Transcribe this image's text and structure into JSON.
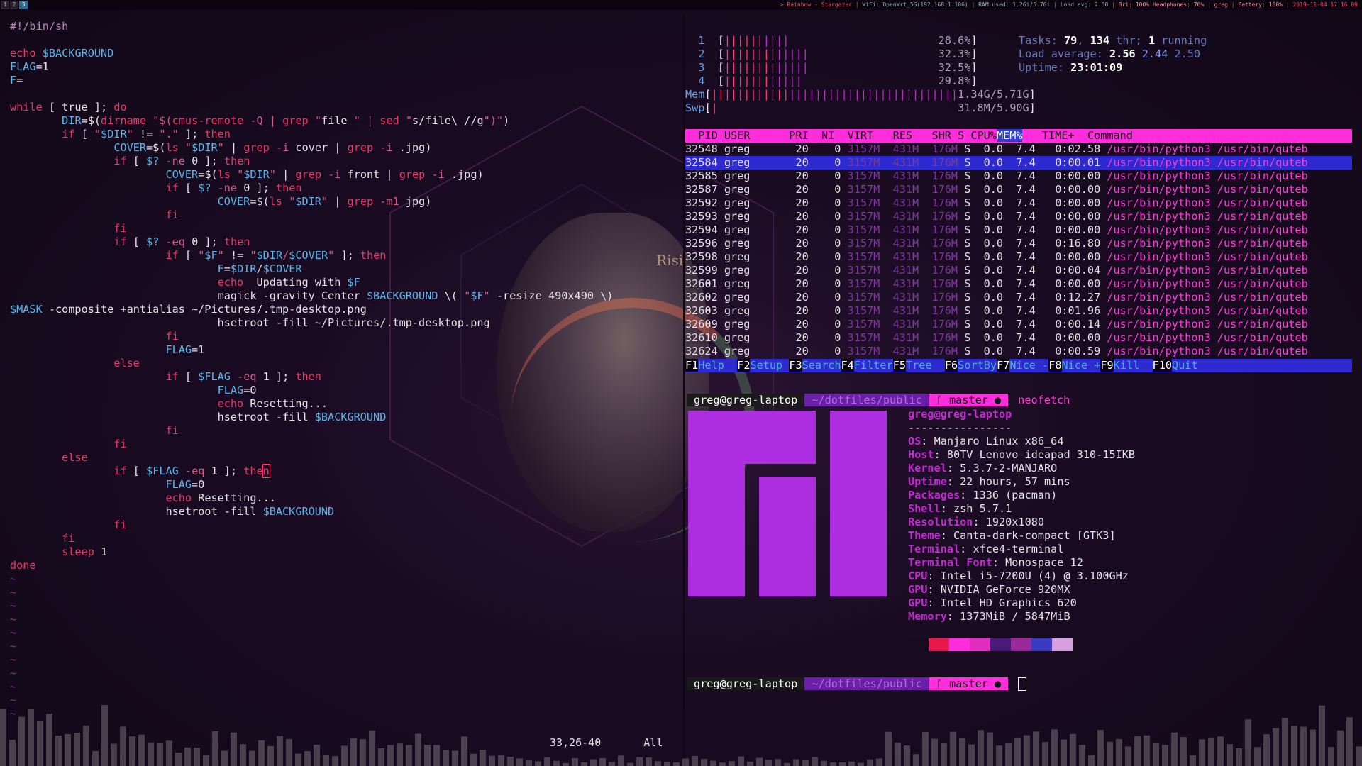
{
  "topbar": {
    "workspaces": [
      "1",
      "2",
      "3"
    ],
    "song": "> Rainbow - Stargazer",
    "wifi": "WiFi: OpenWrt_5G(192.168.1.106)",
    "ram": "RAM used: 1.2Gi/5.7Gi",
    "load": "Load avg: 2.50",
    "bri": "Bri: 100%",
    "headphones": "Headphones: 70%",
    "user": "greg",
    "battery": "Battery: 100%",
    "datetime": "2019-11-04 17:16:09"
  },
  "background": {
    "album_text": "Risi"
  },
  "vim": {
    "lines": [
      "#!/bin/sh",
      "",
      "echo $BACKGROUND",
      "FLAG=1",
      "F=",
      "",
      "while [ true ]; do",
      "        DIR=$(dirname \"$(cmus-remote -Q | grep \"file \" | sed \"s/file\\ //g\")\")",
      "        if [ \"$DIR\" != \".\" ]; then",
      "                COVER=$(ls \"$DIR\" | grep -i cover | grep -i .jpg)",
      "                if [ $? -ne 0 ]; then",
      "                        COVER=$(ls \"$DIR\" | grep -i front | grep -i .jpg)",
      "                        if [ $? -ne 0 ]; then",
      "                                COVER=$(ls \"$DIR\" | grep -m1 jpg)",
      "                        fi",
      "                fi",
      "                if [ $? -eq 0 ]; then",
      "                        if [ \"$F\" != \"$DIR/$COVER\" ]; then",
      "                                F=$DIR/$COVER",
      "                                echo  Updating with $F",
      "                                magick -gravity Center $BACKGROUND \\( \"$F\" -resize 490x490 \\)",
      "$MASK -composite +antialias ~/Pictures/.tmp-desktop.png",
      "                                hsetroot -fill ~/Pictures/.tmp-desktop.png",
      "                        fi",
      "                        FLAG=1",
      "                else",
      "                        if [ $FLAG -eq 1 ]; then",
      "                                FLAG=0",
      "                                echo Resetting...",
      "                                hsetroot -fill $BACKGROUND",
      "                        fi",
      "                fi",
      "        else",
      "                if [ $FLAG -eq 1 ]; then",
      "                        FLAG=0",
      "                        echo Resetting...",
      "                        hsetroot -fill $BACKGROUND",
      "                fi",
      "        fi",
      "        sleep 1",
      "done"
    ],
    "tildes": 11,
    "position": "33,26-40",
    "scroll": "All"
  },
  "htop": {
    "cpus": [
      {
        "id": "1",
        "bar": "||||||||||",
        "val": "28.6%"
      },
      {
        "id": "2",
        "bar": "|||||||||||||",
        "val": "32.3%"
      },
      {
        "id": "3",
        "bar": "|||||||||||||",
        "val": "32.5%"
      },
      {
        "id": "4",
        "bar": "||||||||||||",
        "val": "29.8%"
      }
    ],
    "mem": {
      "label": "Mem",
      "val": "1.34G/5.71G"
    },
    "swp": {
      "label": "Swp",
      "val": "31.8M/5.90G"
    },
    "tasks_label": "Tasks:",
    "tasks": "79",
    "thr": "134",
    "thr_label": "thr;",
    "running": "1",
    "running_label": "running",
    "load_label": "Load average:",
    "load1": "2.56",
    "load5": "2.44",
    "load15": "2.50",
    "uptime_label": "Uptime:",
    "uptime": "23:01:09",
    "header": "  PID USER      PRI  NI  VIRT   RES   SHR S CPU%",
    "header_mem": "MEM%",
    "header_rest": "   TIME+  Command",
    "rows": [
      {
        "pid": "32548",
        "time": "0:02.58"
      },
      {
        "pid": "32584",
        "time": "0:00.01"
      },
      {
        "pid": "32585",
        "time": "0:00.00"
      },
      {
        "pid": "32587",
        "time": "0:00.00"
      },
      {
        "pid": "32592",
        "time": "0:00.00"
      },
      {
        "pid": "32593",
        "time": "0:00.00"
      },
      {
        "pid": "32594",
        "time": "0:00.00"
      },
      {
        "pid": "32596",
        "time": "0:16.80"
      },
      {
        "pid": "32598",
        "time": "0:00.00"
      },
      {
        "pid": "32599",
        "time": "0:00.04"
      },
      {
        "pid": "32601",
        "time": "0:00.00"
      },
      {
        "pid": "32602",
        "time": "0:12.27"
      },
      {
        "pid": "32603",
        "time": "0:01.96"
      },
      {
        "pid": "32609",
        "time": "0:00.14"
      },
      {
        "pid": "32610",
        "time": "0:00.00"
      },
      {
        "pid": "32624",
        "time": "0:00.59"
      }
    ],
    "row_user": "greg",
    "row_pri": "20",
    "row_ni": "0",
    "row_virt": "3157M",
    "row_res": "431M",
    "row_shr": "176M",
    "row_s": "S",
    "row_cpu": "0.0",
    "row_mem": "7.4",
    "row_cmd": "/usr/bin/python3 /usr/bin/quteb",
    "fkeys": [
      {
        "k": "F1",
        "v": "Help  "
      },
      {
        "k": "F2",
        "v": "Setup "
      },
      {
        "k": "F3",
        "v": "Search"
      },
      {
        "k": "F4",
        "v": "Filter"
      },
      {
        "k": "F5",
        "v": "Tree  "
      },
      {
        "k": "F6",
        "v": "SortBy"
      },
      {
        "k": "F7",
        "v": "Nice -"
      },
      {
        "k": "F8",
        "v": "Nice +"
      },
      {
        "k": "F9",
        "v": "Kill  "
      },
      {
        "k": "F10",
        "v": "Quit"
      }
    ]
  },
  "neofetch": {
    "prompt_user": "greg@greg-laptop",
    "prompt_dir": "~/dotfiles/public",
    "prompt_git": "ᚴ master ●",
    "command": "neofetch",
    "title": "greg@greg-laptop",
    "underline": "----------------",
    "info": [
      {
        "k": "OS",
        "v": "Manjaro Linux x86_64"
      },
      {
        "k": "Host",
        "v": "80TV Lenovo ideapad 310-15IKB"
      },
      {
        "k": "Kernel",
        "v": "5.3.7-2-MANJARO"
      },
      {
        "k": "Uptime",
        "v": "22 hours, 57 mins"
      },
      {
        "k": "Packages",
        "v": "1336 (pacman)"
      },
      {
        "k": "Shell",
        "v": "zsh 5.7.1"
      },
      {
        "k": "Resolution",
        "v": "1920x1080"
      },
      {
        "k": "Theme",
        "v": "Canta-dark-compact [GTK3]"
      },
      {
        "k": "Terminal",
        "v": "xfce4-terminal"
      },
      {
        "k": "Terminal Font",
        "v": "Monospace 12"
      },
      {
        "k": "CPU",
        "v": "Intel i5-7200U (4) @ 3.100GHz"
      },
      {
        "k": "GPU",
        "v": "NVIDIA GeForce 920MX"
      },
      {
        "k": "GPU",
        "v": "Intel HD Graphics 620"
      },
      {
        "k": "Memory",
        "v": "1373MiB / 5847MiB"
      }
    ],
    "swatches": [
      "#1a0a20",
      "#e8184a",
      "#ff2ddb",
      "#e02dc0",
      "#4a1a78",
      "#9a2a9a",
      "#3a3ac0",
      "#d8a0e0"
    ]
  },
  "colors": {
    "accent": "#ff2ddb",
    "logo": "#ac2ee0",
    "selection": "#2c2ad0"
  }
}
